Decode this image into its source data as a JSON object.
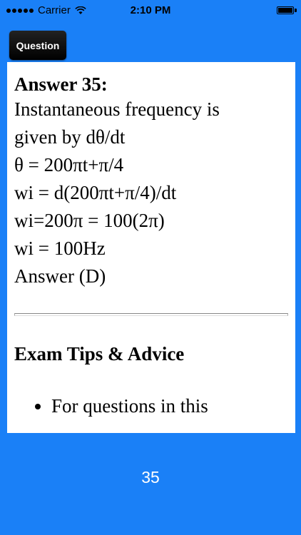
{
  "status_bar": {
    "carrier": "Carrier",
    "time": "2:10 PM",
    "signal_icon": "signal-dots-icon",
    "wifi_icon": "wifi-icon",
    "battery_icon": "battery-icon",
    "battery_level": 1.0
  },
  "nav": {
    "question_label": "Question"
  },
  "answer": {
    "heading": "Answer 35:",
    "lines": [
      "Instantaneous frequency is",
      "given by dθ/dt",
      "θ = 200πt+π/4",
      "wi = d(200πt+π/4)/dt",
      "wi=200π = 100(2π)",
      "wi = 100Hz",
      "Answer (D)"
    ]
  },
  "tips": {
    "heading": "Exam Tips & Advice",
    "items": [
      "For questions in this"
    ]
  },
  "footer": {
    "page_number": "35"
  },
  "colors": {
    "background": "#1a80f7",
    "panel": "#ffffff",
    "button": "#000000"
  }
}
